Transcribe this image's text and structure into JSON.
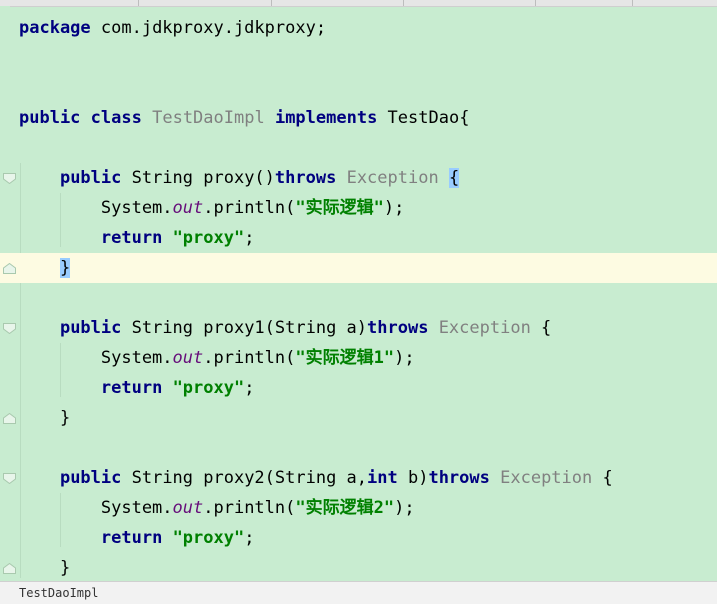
{
  "editor": {
    "lines": [
      {
        "tokens": [
          {
            "t": "package",
            "c": "kw"
          },
          {
            "t": " com.jdkproxy.jdkproxy;",
            "c": ""
          }
        ]
      },
      {
        "tokens": []
      },
      {
        "tokens": []
      },
      {
        "tokens": [
          {
            "t": "public",
            "c": "kw"
          },
          {
            "t": " ",
            "c": ""
          },
          {
            "t": "class",
            "c": "kw"
          },
          {
            "t": " ",
            "c": ""
          },
          {
            "t": "TestDaoImpl",
            "c": "gray"
          },
          {
            "t": " ",
            "c": ""
          },
          {
            "t": "implements",
            "c": "kw"
          },
          {
            "t": " TestDao{",
            "c": ""
          }
        ]
      },
      {
        "tokens": []
      },
      {
        "fold": "open",
        "tokens": [
          {
            "t": "    ",
            "c": ""
          },
          {
            "t": "public",
            "c": "kw"
          },
          {
            "t": " String proxy()",
            "c": ""
          },
          {
            "t": "throws",
            "c": "kw"
          },
          {
            "t": " ",
            "c": ""
          },
          {
            "t": "Exception",
            "c": "gray"
          },
          {
            "t": " ",
            "c": ""
          },
          {
            "t": "{",
            "c": "brace-hl"
          }
        ]
      },
      {
        "tokens": [
          {
            "t": "        System.",
            "c": ""
          },
          {
            "t": "out",
            "c": "field"
          },
          {
            "t": ".println(",
            "c": ""
          },
          {
            "t": "\"实际逻辑\"",
            "c": "str"
          },
          {
            "t": ");",
            "c": ""
          }
        ]
      },
      {
        "tokens": [
          {
            "t": "        ",
            "c": ""
          },
          {
            "t": "return",
            "c": "kw"
          },
          {
            "t": " ",
            "c": ""
          },
          {
            "t": "\"proxy\"",
            "c": "str"
          },
          {
            "t": ";",
            "c": ""
          }
        ]
      },
      {
        "current": true,
        "fold": "close",
        "tokens": [
          {
            "t": "    ",
            "c": ""
          },
          {
            "t": "}",
            "c": "brace-hl"
          }
        ]
      },
      {
        "tokens": []
      },
      {
        "fold": "open",
        "tokens": [
          {
            "t": "    ",
            "c": ""
          },
          {
            "t": "public",
            "c": "kw"
          },
          {
            "t": " String proxy1(String a)",
            "c": ""
          },
          {
            "t": "throws",
            "c": "kw"
          },
          {
            "t": " ",
            "c": ""
          },
          {
            "t": "Exception",
            "c": "gray"
          },
          {
            "t": " {",
            "c": ""
          }
        ]
      },
      {
        "tokens": [
          {
            "t": "        System.",
            "c": ""
          },
          {
            "t": "out",
            "c": "field"
          },
          {
            "t": ".println(",
            "c": ""
          },
          {
            "t": "\"实际逻辑1\"",
            "c": "str"
          },
          {
            "t": ");",
            "c": ""
          }
        ]
      },
      {
        "tokens": [
          {
            "t": "        ",
            "c": ""
          },
          {
            "t": "return",
            "c": "kw"
          },
          {
            "t": " ",
            "c": ""
          },
          {
            "t": "\"proxy\"",
            "c": "str"
          },
          {
            "t": ";",
            "c": ""
          }
        ]
      },
      {
        "fold": "close",
        "tokens": [
          {
            "t": "    }",
            "c": ""
          }
        ]
      },
      {
        "tokens": []
      },
      {
        "fold": "open",
        "tokens": [
          {
            "t": "    ",
            "c": ""
          },
          {
            "t": "public",
            "c": "kw"
          },
          {
            "t": " String proxy2(String a,",
            "c": ""
          },
          {
            "t": "int",
            "c": "kw"
          },
          {
            "t": " b)",
            "c": ""
          },
          {
            "t": "throws",
            "c": "kw"
          },
          {
            "t": " ",
            "c": ""
          },
          {
            "t": "Exception",
            "c": "gray"
          },
          {
            "t": " {",
            "c": ""
          }
        ]
      },
      {
        "tokens": [
          {
            "t": "        System.",
            "c": ""
          },
          {
            "t": "out",
            "c": "field"
          },
          {
            "t": ".println(",
            "c": ""
          },
          {
            "t": "\"实际逻辑2\"",
            "c": "str"
          },
          {
            "t": ");",
            "c": ""
          }
        ]
      },
      {
        "tokens": [
          {
            "t": "        ",
            "c": ""
          },
          {
            "t": "return",
            "c": "kw"
          },
          {
            "t": " ",
            "c": ""
          },
          {
            "t": "\"proxy\"",
            "c": "str"
          },
          {
            "t": ";",
            "c": ""
          }
        ]
      },
      {
        "fold": "close",
        "tokens": [
          {
            "t": "    }",
            "c": ""
          }
        ]
      }
    ]
  },
  "statusbar": {
    "label": "TestDaoImpl"
  },
  "colors": {
    "background": "#c8ecd0",
    "current_line": "#fdfbe2",
    "keyword": "#000080",
    "string": "#008000",
    "field": "#660e7a",
    "dim": "#808080",
    "brace_match": "#99ccff"
  },
  "icons": {
    "fold_open": "fold-open-icon",
    "fold_close": "fold-close-icon"
  }
}
